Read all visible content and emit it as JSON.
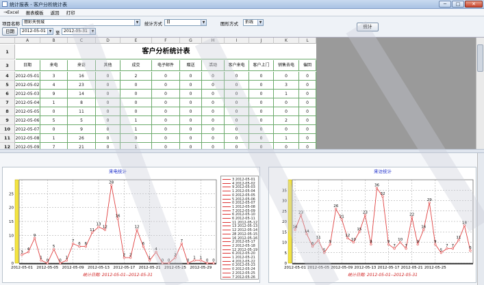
{
  "window": {
    "title": "统计报表 - 客户分析统计表",
    "min": "─",
    "max": "□",
    "close": "✕"
  },
  "menu": [
    "→Excel",
    "报表模板",
    "返回",
    "打印"
  ],
  "filters": {
    "project_label": "项目名称",
    "project_value": "丽彩天悦城",
    "stat_label": "统计方式",
    "stat_value": "日",
    "chart_label": "图形方式",
    "chart_value": "折线",
    "date_button": "日期",
    "date_from": "2012-05-01",
    "date_to_label": "至",
    "date_to": "2012-05-31",
    "stat_button": "统计"
  },
  "sheet": {
    "columns": [
      "A",
      "B",
      "C",
      "D",
      "E",
      "F",
      "G",
      "H",
      "I",
      "J",
      "K",
      "L",
      "M"
    ],
    "title": "客户分析统计表",
    "headers": [
      "日期",
      "来电",
      "来访",
      "其他",
      "成交",
      "电子邮件",
      "赠送",
      "活动",
      "客户来电",
      "客户上门",
      "销售去电",
      "催回"
    ],
    "rows": [
      {
        "n": "4",
        "v": [
          "2012-05-01",
          "3",
          "16",
          "0",
          "2",
          "0",
          "0",
          "0",
          "0",
          "0",
          "0",
          "0"
        ]
      },
      {
        "n": "5",
        "v": [
          "2012-05-02",
          "4",
          "23",
          "0",
          "0",
          "0",
          "0",
          "0",
          "0",
          "0",
          "3",
          "0"
        ]
      },
      {
        "n": "6",
        "v": [
          "2012-05-03",
          "9",
          "14",
          "0",
          "0",
          "0",
          "0",
          "0",
          "0",
          "0",
          "1",
          "0"
        ]
      },
      {
        "n": "7",
        "v": [
          "2012-05-04",
          "1",
          "8",
          "0",
          "0",
          "0",
          "0",
          "0",
          "0",
          "0",
          "0",
          "0"
        ]
      },
      {
        "n": "8",
        "v": [
          "2012-05-05",
          "0",
          "11",
          "0",
          "0",
          "0",
          "0",
          "0",
          "0",
          "0",
          "0",
          "0"
        ]
      },
      {
        "n": "9",
        "v": [
          "2012-05-06",
          "5",
          "5",
          "0",
          "1",
          "0",
          "0",
          "0",
          "0",
          "0",
          "2",
          "0"
        ]
      },
      {
        "n": "10",
        "v": [
          "2012-05-07",
          "0",
          "9",
          "0",
          "1",
          "0",
          "0",
          "0",
          "0",
          "0",
          "0",
          "0"
        ]
      },
      {
        "n": "11",
        "v": [
          "2012-05-08",
          "1",
          "26",
          "0",
          "0",
          "0",
          "0",
          "0",
          "0",
          "0",
          "1",
          "0"
        ]
      },
      {
        "n": "12",
        "v": [
          "2012-05-09",
          "7",
          "21",
          "0",
          "1",
          "0",
          "0",
          "0",
          "0",
          "0",
          "0",
          "0"
        ]
      }
    ]
  },
  "chart_data": [
    {
      "type": "line",
      "title": "来电统计",
      "subtitle": "统计日期: 2012-05-01--2012-05-31",
      "x": [
        "2012-05-01",
        "2012-05-02",
        "2012-05-03",
        "2012-05-04",
        "2012-05-05",
        "2012-05-06",
        "2012-05-07",
        "2012-05-08",
        "2012-05-09",
        "2012-05-10",
        "2012-05-11",
        "2012-05-12",
        "2012-05-13",
        "2012-05-14",
        "2012-05-15",
        "2012-05-16",
        "2012-05-17",
        "2012-05-18",
        "2012-05-19",
        "2012-05-20",
        "2012-05-21",
        "2012-05-22",
        "2012-05-23",
        "2012-05-24",
        "2012-05-25",
        "2012-05-26",
        "2012-05-27",
        "2012-05-28",
        "2012-05-29",
        "2012-05-30",
        "2012-05-31"
      ],
      "values": [
        3,
        4,
        9,
        1,
        0,
        5,
        0,
        1,
        7,
        6,
        6,
        11,
        13,
        12,
        28,
        16,
        2,
        2,
        12,
        6,
        1,
        4,
        0,
        0,
        2,
        7,
        0,
        1,
        1,
        0,
        0
      ],
      "xticks": [
        "2012-05-01",
        "2012-05-05",
        "2012-05-09",
        "2012-05-13",
        "2012-05-17",
        "2012-05-21",
        "2012-05-25",
        "2012-05-29"
      ],
      "yticks": [
        "0",
        "5",
        "10",
        "15",
        "20",
        "25"
      ],
      "ylim": [
        0,
        30
      ],
      "legend": [
        "3 2012-05-01",
        "4 2012-05-02",
        "9 2012-05-03",
        "1 2012-05-04",
        "0 2012-05-05",
        "5 2012-05-06",
        "0 2012-05-07",
        "1 2012-05-08",
        "7 2012-05-09",
        "6 2012-05-10",
        "6 2012-05-11",
        "11 2012-05-12",
        "13 2012-05-13",
        "12 2012-05-14",
        "28 2012-05-15",
        "16 2012-05-16",
        "2 2012-05-17",
        "2 2012-05-18",
        "12 2012-05-19",
        "6 2012-05-20",
        "1 2012-05-21",
        "4 2012-05-22",
        "0 2012-05-23",
        "0 2012-05-24",
        "2 2012-05-25",
        "7 2012-05-26"
      ],
      "legend_position": "right",
      "grid": true,
      "line_color": "#e04040"
    },
    {
      "type": "line",
      "title": "来访统计",
      "subtitle": "统计日期: 2012-05-01--2012-05-31",
      "x": [
        "2012-05-01",
        "2012-05-02",
        "2012-05-03",
        "2012-05-04",
        "2012-05-05",
        "2012-05-06",
        "2012-05-07",
        "2012-05-08",
        "2012-05-09",
        "2012-05-10",
        "2012-05-11",
        "2012-05-12",
        "2012-05-13",
        "2012-05-14",
        "2012-05-15",
        "2012-05-16",
        "2012-05-17",
        "2012-05-18",
        "2012-05-19",
        "2012-05-20",
        "2012-05-21",
        "2012-05-22",
        "2012-05-23",
        "2012-05-24",
        "2012-05-25",
        "2012-05-26",
        "2012-05-27",
        "2012-05-28",
        "2012-05-29",
        "2012-05-30",
        "2012-05-31"
      ],
      "values": [
        16,
        23,
        14,
        8,
        11,
        5,
        9,
        26,
        21,
        12,
        10,
        15,
        23,
        9,
        36,
        32,
        9,
        7,
        10,
        7,
        22,
        9,
        16,
        29,
        9,
        5,
        7,
        7,
        11,
        18,
        6
      ],
      "xticks": [
        "2012-05-01",
        "2012-05-05",
        "2012-05-09",
        "2012-05-13",
        "2012-05-17",
        "2012-05-21",
        "2012-05-25"
      ],
      "yticks": [
        "0",
        "5",
        "10",
        "15",
        "20",
        "25",
        "30",
        "35"
      ],
      "ylim": [
        0,
        40
      ],
      "grid": true,
      "line_color": "#e04040"
    }
  ]
}
